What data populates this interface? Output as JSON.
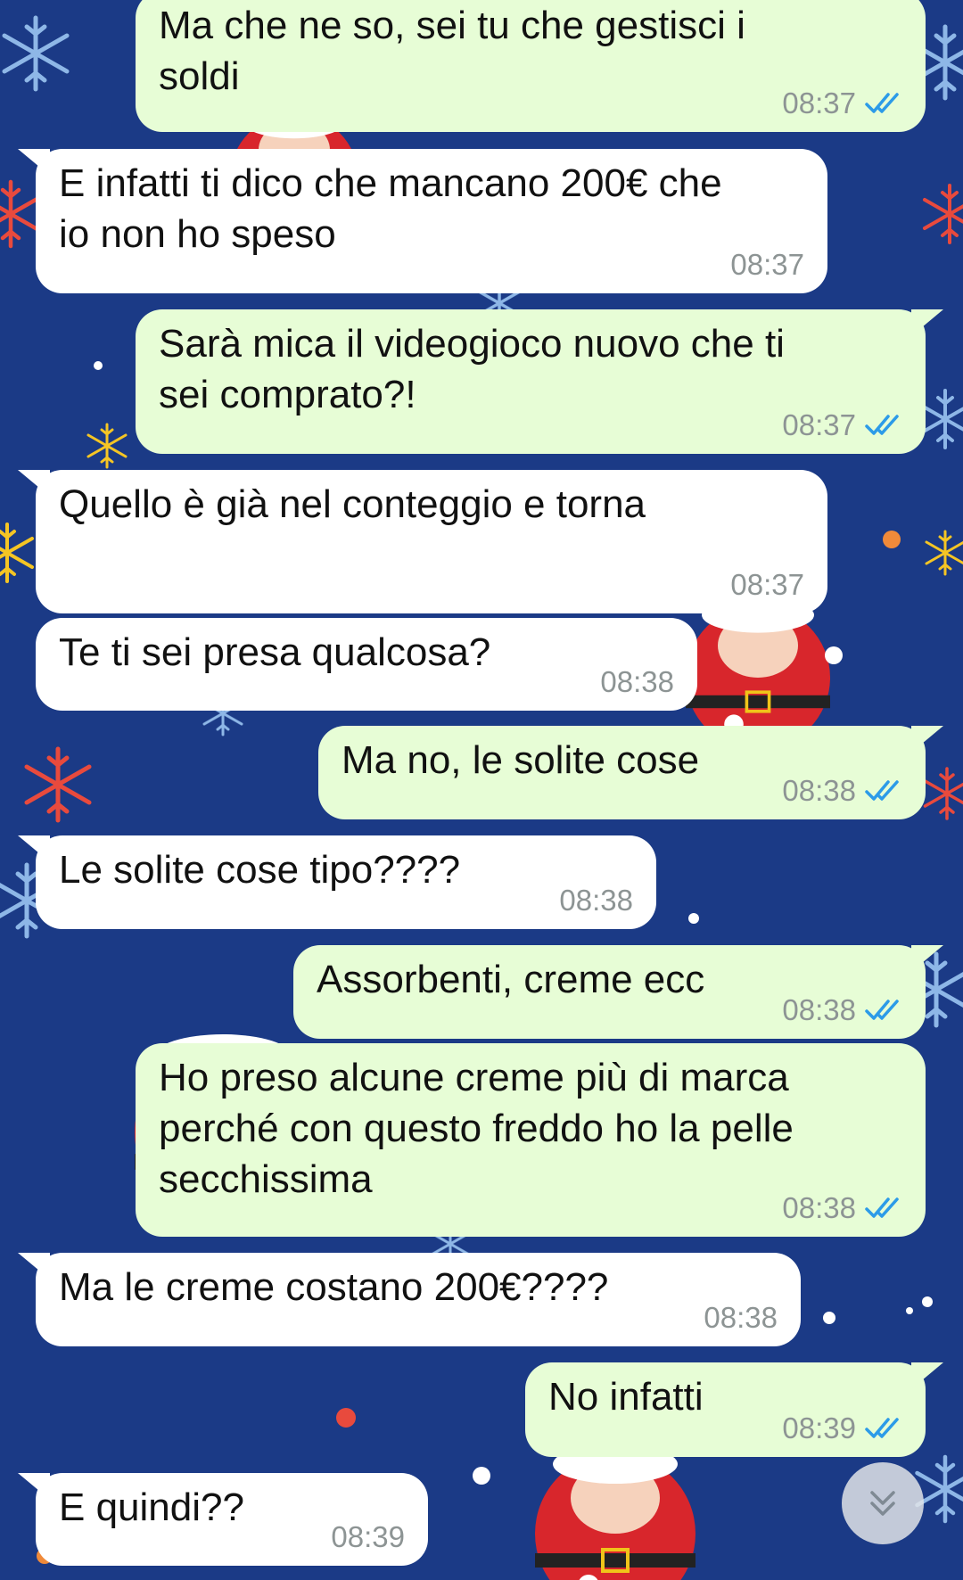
{
  "colors": {
    "wallpaper": "#1b3a86",
    "incoming_bubble": "#ffffff",
    "outgoing_bubble": "#e7fdd6",
    "timestamp": "#8d9494",
    "read_ticks": "#2c9be8"
  },
  "icons": {
    "read_receipt": "double-check-icon",
    "scroll_down": "double-chevron-down-icon"
  },
  "messages": [
    {
      "direction": "out",
      "text": "Ma che ne so, sei tu che gestisci i\nsoldi",
      "time": "08:37",
      "read": true
    },
    {
      "direction": "in",
      "text": "E infatti ti dico che mancano 200€ che\nio non ho speso",
      "time": "08:37"
    },
    {
      "direction": "out",
      "text": "Sarà mica il videogioco nuovo che ti\nsei comprato?!",
      "time": "08:37",
      "read": true
    },
    {
      "direction": "in",
      "text": "Quello è già nel conteggio e torna",
      "time": "08:37"
    },
    {
      "direction": "in",
      "text": "Te ti sei presa qualcosa?",
      "time": "08:38"
    },
    {
      "direction": "out",
      "text": "Ma no, le solite cose",
      "time": "08:38",
      "read": true
    },
    {
      "direction": "in",
      "text": "Le solite cose tipo????",
      "time": "08:38"
    },
    {
      "direction": "out",
      "text": "Assorbenti, creme ecc",
      "time": "08:38",
      "read": true
    },
    {
      "direction": "out",
      "text": "Ho preso alcune creme più di marca\nperché con questo freddo ho la pelle\nsecchissima",
      "time": "08:38",
      "read": true
    },
    {
      "direction": "in",
      "text": "Ma le creme costano 200€????",
      "time": "08:38"
    },
    {
      "direction": "out",
      "text": "No infatti",
      "time": "08:39",
      "read": true
    },
    {
      "direction": "in",
      "text": "E quindi??",
      "time": "08:39"
    }
  ]
}
